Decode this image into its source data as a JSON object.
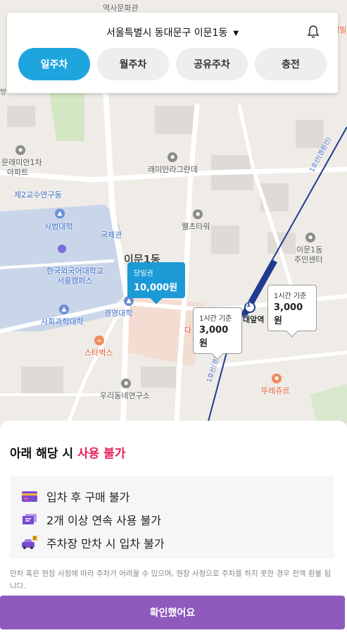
{
  "header": {
    "location": "서울특별시 동대문구 이문1동",
    "tabs": [
      {
        "label": "일주차",
        "active": true
      },
      {
        "label": "월주차",
        "active": false
      },
      {
        "label": "공유주차",
        "active": false
      },
      {
        "label": "충전",
        "active": false
      }
    ]
  },
  "map": {
    "labels": {
      "museum": "역사문화관",
      "right_edge": "리빌",
      "apt": "문래미안1차\n아파트",
      "apt1": "문래미안1차",
      "apt2": "아파트",
      "building2": "제2교수연구동",
      "ramian": "래미안라그란데",
      "sabum": "사범대학",
      "gukje": "국제관",
      "welch": "웰츠타워",
      "imun1dong": "이문1동",
      "campus1": "한국외국어대학교",
      "campus2": "서울캠퍼스",
      "gyeongyoung": "경영대학",
      "social": "사회과학대학",
      "starbucks": "스타벅스",
      "uri": "우리동네연구소",
      "community1": "이문1동",
      "community2": "주민센터",
      "station": "외대앞역",
      "station_partial": "대앞역",
      "line1": "1호선(경원선)",
      "line1b": "1호선(경원선)",
      "tours": "뚜레쥬르",
      "da": "다",
      "bang": "방"
    },
    "station_number": "1",
    "price_tags": [
      {
        "line1": "당일권",
        "line2": "10,000원",
        "active": true
      },
      {
        "line1": "1시간 기준",
        "line2": "3,000원",
        "active": false
      },
      {
        "line1": "1시간 기준",
        "line2": "3,000원",
        "active": false
      }
    ]
  },
  "sheet": {
    "title_prefix": "아래 해당 시 ",
    "title_highlight": "사용 불가",
    "conditions": [
      {
        "icon": "card-icon",
        "text": "입차 후 구매 불가"
      },
      {
        "icon": "ticket-icon",
        "text": "2개 이상 연속 사용 불가"
      },
      {
        "icon": "car-parking-icon",
        "text": "주차장 만차 시 입차 불가"
      }
    ],
    "notice": "만차 혹은 현장 사정에 따라 주차가 어려울 수 있으며, 현장 사정으로 주차를 하지 못한 경우 전액 환불 됩니다.",
    "confirm_label": "확인했어요"
  },
  "colors": {
    "accent": "#1ea5dd",
    "highlight": "#e8235a",
    "confirm": "#8e5bbd"
  }
}
